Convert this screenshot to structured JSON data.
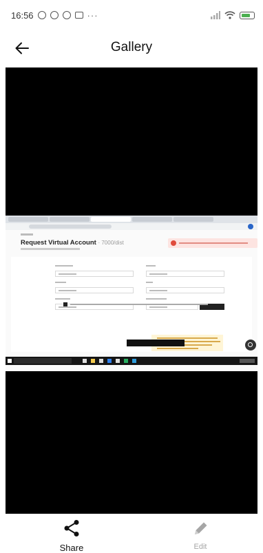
{
  "status_bar": {
    "time": "16:56",
    "overflow": "···",
    "icons": [
      "alarm-icon",
      "notification-icon",
      "notification-icon",
      "gallery-icon",
      "signal-icon",
      "wifi-icon",
      "battery-icon"
    ]
  },
  "app_bar": {
    "title": "Gallery",
    "back_icon": "arrow-left-icon"
  },
  "screenshot_content": {
    "heading": "Request Virtual Account",
    "heading_suffix": "· 7000/dist"
  },
  "bottom_actions": {
    "share_label": "Share",
    "edit_label": "Edit"
  },
  "colors": {
    "viewer_background": "#000000",
    "share_color": "#111111",
    "edit_color": "#a6a6a6"
  }
}
